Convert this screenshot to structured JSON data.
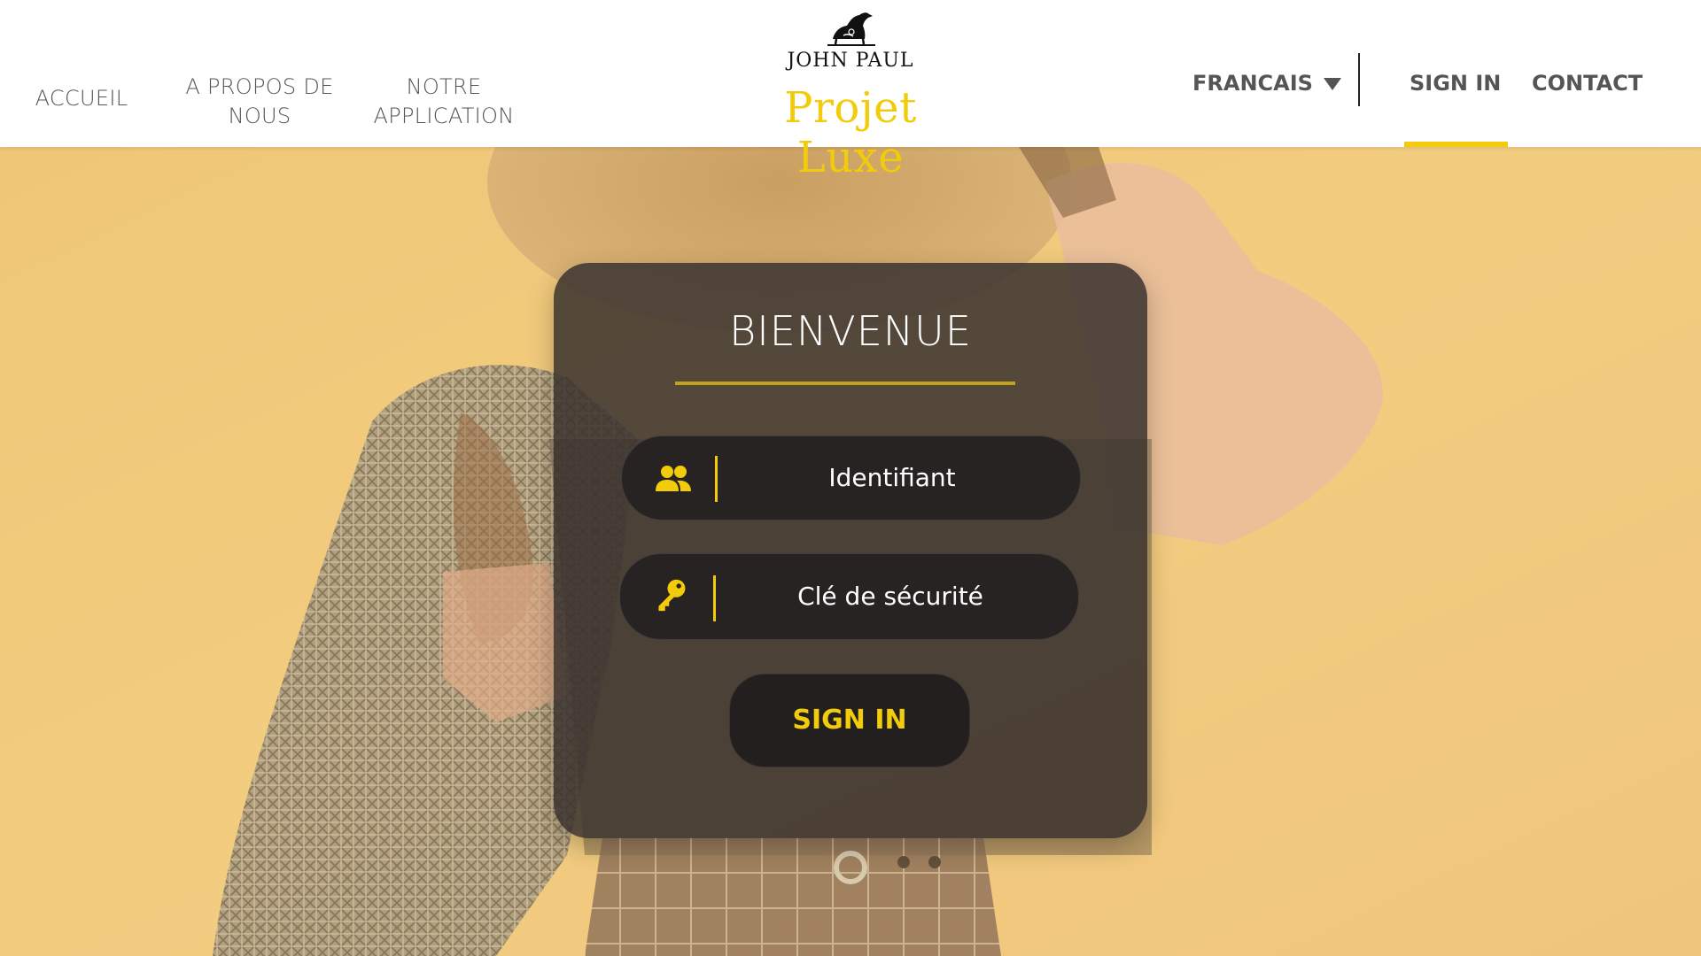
{
  "header": {
    "nav_left": {
      "accueil": "ACCUEIL",
      "apropos_line1": "A PROPOS DE",
      "apropos_line2": "NOUS",
      "appli_line1": "NOTRE",
      "appli_line2": "APPLICATION"
    },
    "logo": {
      "brand": "JOHN PAUL",
      "title": "Projet Luxe"
    },
    "language": "FRANCAIS",
    "nav_right": {
      "signin": "SIGN IN",
      "contact": "CONTACT"
    },
    "active_tab": "SIGN IN"
  },
  "login": {
    "title": "BIENVENUE",
    "identifier_placeholder": "Identifiant",
    "security_key_placeholder": "Clé de sécurité",
    "submit_label": "SIGN IN",
    "identifier_icon": "users-icon",
    "key_icon": "key-icon"
  },
  "colors": {
    "accent": "#f2cb0a",
    "card_background": "#3a322f",
    "field_background": "#262322",
    "page_background": "#f0c878",
    "nav_text": "#555555"
  }
}
